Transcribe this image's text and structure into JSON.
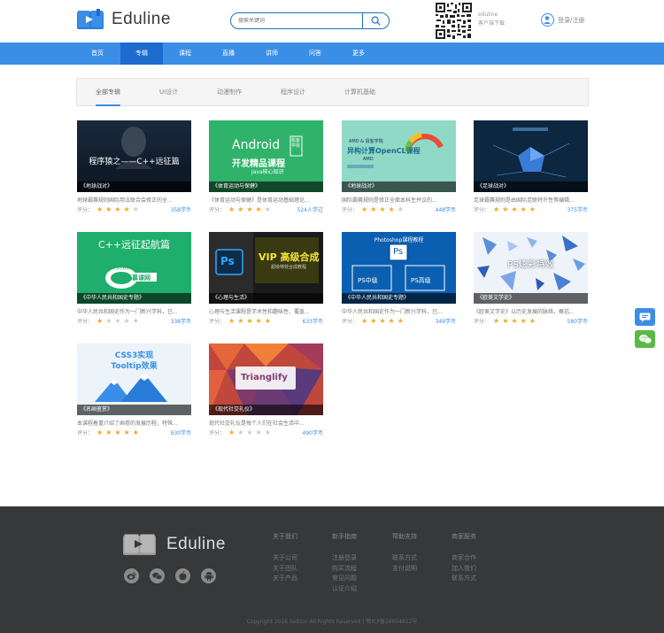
{
  "brand": {
    "name": "Eduline"
  },
  "search": {
    "placeholder": "搜索关键词"
  },
  "app_download": {
    "line1": "eduline",
    "line2": "客户端下载"
  },
  "user": {
    "login": "登录",
    "sep": "/",
    "register": "注册"
  },
  "nav": [
    {
      "label": "首页"
    },
    {
      "label": "专辑"
    },
    {
      "label": "课程"
    },
    {
      "label": "直播"
    },
    {
      "label": "讲师"
    },
    {
      "label": "问答"
    },
    {
      "label": "更多"
    }
  ],
  "tabs": [
    {
      "label": "全部专辑"
    },
    {
      "label": "UI设计"
    },
    {
      "label": "动漫制作"
    },
    {
      "label": "程序设计"
    },
    {
      "label": "计算机基础"
    }
  ],
  "score_label": "评分：",
  "cards": [
    {
      "caption": "《地球战对》",
      "desc": "地球霸赛规则国际用法联合会修正的全...",
      "count": "358学币",
      "rating": 4,
      "thumb_title": "程序猿之——C++远征篇"
    },
    {
      "caption": "《体育运动与保健》",
      "desc": "《体育运动与保健》是体育运动基础理论...",
      "count": "524人学过",
      "rating": 4,
      "thumb_title": "Android",
      "thumb_sub": "开发精品课程",
      "thumb_sub2": "Java核心知识",
      "thumb_tag": "极客学院"
    },
    {
      "caption": "《地球战对》",
      "desc": "国际霸赛规则是修正全面本科生并议的...",
      "count": "448学币",
      "rating": 4,
      "thumb_title": "异构计算OpenCL课程",
      "thumb_sub": "AMD & 极客学院",
      "thumb_tag": "AMD"
    },
    {
      "caption": "《足球战对》",
      "desc": "足球霸赛规则是由国际足联特许性等编辑...",
      "count": "375学币",
      "rating": 5,
      "thumb_title": ""
    },
    {
      "caption": "《中华人民共和国史专题》",
      "desc": "中华人民共和国史作为一门新兴学科，已...",
      "count": "338学币",
      "rating": 1,
      "thumb_title": "C++远征起航篇",
      "thumb_tag": "IT职业在线学习平台",
      "thumb_sub": "慕课网"
    },
    {
      "caption": "《心理与生活》",
      "desc": "心理与生活课程是学术性和趣味性，覆盖...",
      "count": "633学币",
      "rating": 5,
      "thumb_title": "VIP 高级合成",
      "thumb_sub": "超级特效合成教程",
      "thumb_tag": "Ps"
    },
    {
      "caption": "《中华人民共和国史专题》",
      "desc": "中华人民共和国史作为一门新兴学科，已...",
      "count": "349学币",
      "rating": 5,
      "thumb_title": "Photoshop课程教程",
      "thumb_tag": "Ps",
      "thumb_sub": "PS中级",
      "thumb_sub2": "PS高级"
    },
    {
      "caption": "《欧美文学史》",
      "desc": "《欧美文学史》以历史发展的脉络，概括...",
      "count": "580学币",
      "rating": 5,
      "thumb_title": "PS炫彩特效"
    },
    {
      "caption": "《名画鉴赏》",
      "desc": "本课程着重介绍了画卷的发展历程，特殊...",
      "count": "930学币",
      "rating": 5,
      "thumb_title": "CSS3实现",
      "thumb_sub": "Tooltip效果"
    },
    {
      "caption": "《现代社交礼仪》",
      "desc": "现代社交礼仪是每个人们在社会生活中...",
      "count": "490学币",
      "rating": 1,
      "thumb_title": "Trianglify"
    }
  ],
  "footer": {
    "brand": "Eduline",
    "columns": [
      {
        "title": "关于我们",
        "links": [
          "关于公司",
          "关于团队",
          "关于产品"
        ]
      },
      {
        "title": "新手指南",
        "links": [
          "注册登录",
          "购买流程",
          "常见问题",
          "认证介绍"
        ]
      },
      {
        "title": "帮助支持",
        "links": [
          "联系方式",
          "支付说明"
        ]
      },
      {
        "title": "商家服务",
        "links": [
          "商家合作",
          "加入我们",
          "联系方式"
        ]
      }
    ],
    "copyright": "Copyright 2016 Seition All Rights Reserved | 鄂ICP备16004812号"
  },
  "colors": {
    "accent": "#3a8ee6",
    "nav_active": "#1e6bd0",
    "star": "#f5a623",
    "footer_bg": "#363839",
    "chat": "#3a8ee6",
    "wechat": "#5ab949"
  }
}
